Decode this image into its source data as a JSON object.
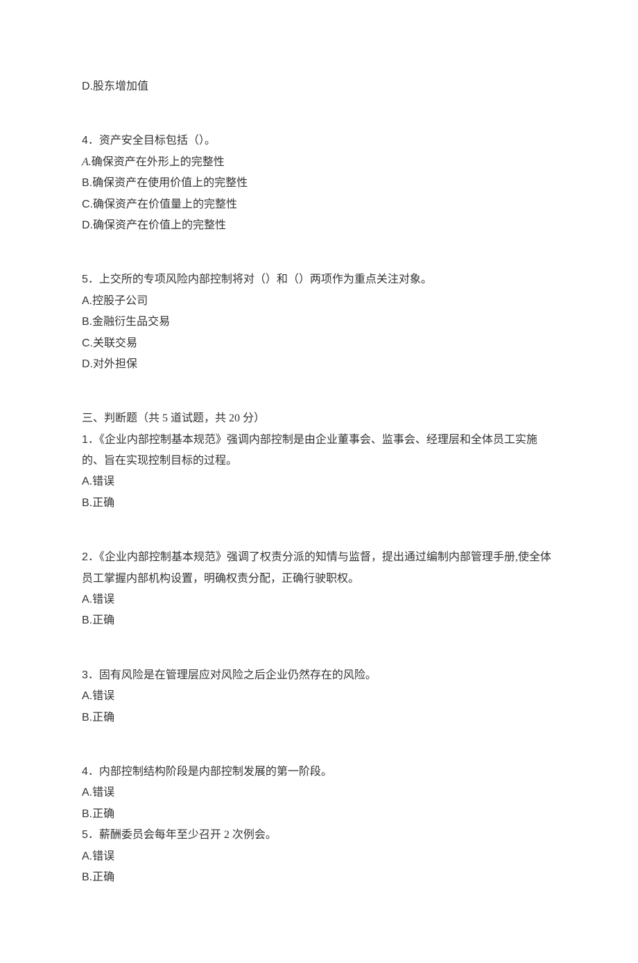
{
  "leading_option": {
    "label": "D.",
    "text": "股东增加值"
  },
  "q4": {
    "number": "4",
    "stem": "．资产安全目标包括（）。",
    "options": [
      {
        "label_italic": "A.",
        "text": "确保资产在外形上的完整性"
      },
      {
        "label": "B.",
        "text": "确保资产在使用价值上的完整性"
      },
      {
        "label": "C.",
        "text": "确保资产在价值量上的完整性"
      },
      {
        "label": "D.",
        "text": "确保资产在价值上的完整性"
      }
    ]
  },
  "q5": {
    "number": "5",
    "stem": "．上交所的专项风险内部控制将对（）和（）两项作为重点关注对象。",
    "options": [
      {
        "label": "A.",
        "text": "控股子公司"
      },
      {
        "label": "B.",
        "text": "金融衍生品交易"
      },
      {
        "label": "C.",
        "text": "关联交易"
      },
      {
        "label": "D.",
        "text": "对外担保"
      }
    ]
  },
  "section3": {
    "title": "三、判断题（共 5 道试题，共 20 分）"
  },
  "t1": {
    "number": "1",
    "stem": "．《企业内部控制基本规范》强调内部控制是由企业董事会、监事会、经理层和全体员工实施的、旨在实现控制目标的过程。",
    "options": [
      {
        "label": "A.",
        "text": "错误"
      },
      {
        "label": "B.",
        "text": "正确"
      }
    ]
  },
  "t2": {
    "number": "2",
    "stem": "．《企业内部控制基本规范》强调了权责分派的知情与监督，提出通过编制内部管理手册,使全体员工掌握内部机构设置，明确权责分配，正确行驶职权。",
    "options": [
      {
        "label": "A.",
        "text": "错误"
      },
      {
        "label": "B.",
        "text": "正确"
      }
    ]
  },
  "t3": {
    "number": "3",
    "stem": "．固有风险是在管理层应对风险之后企业仍然存在的风险。",
    "options": [
      {
        "label": "A.",
        "text": "错误"
      },
      {
        "label": "B.",
        "text": "正确"
      }
    ]
  },
  "t4": {
    "number": "4",
    "stem": "．内部控制结构阶段是内部控制发展的第一阶段。",
    "options": [
      {
        "label": "A.",
        "text": "错误"
      },
      {
        "label": "B.",
        "text": "正确"
      }
    ]
  },
  "t5": {
    "number": "5",
    "stem": "．薪酬委员会每年至少召开 2 次例会。",
    "options": [
      {
        "label": "A.",
        "text": "错误"
      },
      {
        "label": "B.",
        "text": "正确"
      }
    ]
  }
}
